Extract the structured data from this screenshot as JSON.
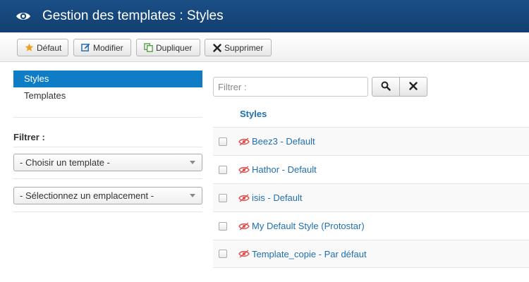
{
  "header": {
    "title": "Gestion des templates : Styles",
    "icon": "eye-icon"
  },
  "toolbar": {
    "buttons": [
      {
        "label": "Défaut",
        "icon": "star-icon",
        "icon_color": "#f0a020"
      },
      {
        "label": "Modifier",
        "icon": "edit-icon",
        "icon_color": "#2a6db0"
      },
      {
        "label": "Dupliquer",
        "icon": "copy-icon",
        "icon_color": "#4a9a3a"
      },
      {
        "label": "Supprimer",
        "icon": "close-icon",
        "icon_color": "#222222"
      }
    ]
  },
  "sidebar": {
    "nav": [
      {
        "label": "Styles",
        "active": true
      },
      {
        "label": "Templates",
        "active": false
      }
    ],
    "filter_title": "Filtrer :",
    "selects": [
      {
        "value": "- Choisir un template -"
      },
      {
        "value": "- Sélectionnez un emplacement -"
      }
    ]
  },
  "search": {
    "placeholder": "Filtrer :"
  },
  "table": {
    "column_header": "Styles",
    "rows": [
      {
        "name": "Beez3 - Default"
      },
      {
        "name": "Hathor - Default"
      },
      {
        "name": "isis - Default"
      },
      {
        "name": "My Default Style (Protostar)"
      },
      {
        "name": "Template_copie - Par défaut"
      }
    ]
  },
  "colors": {
    "header_bg": "#1a4f86",
    "active_nav": "#0f7cc6",
    "link": "#1f6fb0",
    "eye_off": "#e05050"
  }
}
